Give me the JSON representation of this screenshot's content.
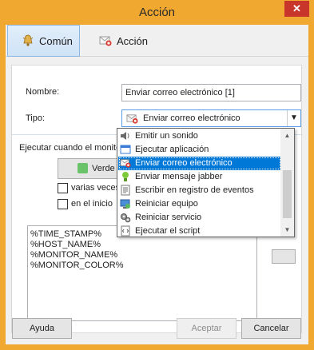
{
  "window": {
    "title": "Acción",
    "close_glyph": "✕"
  },
  "tabs": [
    {
      "label": "Común",
      "icon": "bell-icon",
      "active": true
    },
    {
      "label": "Acción",
      "icon": "action-email-icon",
      "active": false
    }
  ],
  "form": {
    "name_label": "Nombre:",
    "name_value": "Enviar correo electrónico [1]",
    "type_label": "Tipo:",
    "type_value": "Enviar correo electrónico",
    "execute_label": "Ejecutar cuando el monito",
    "state_button_label": "Verde",
    "state_color": "#6ac36a",
    "check_multiple_label": "varias veces",
    "check_start_label": "en el inicio",
    "message_lines": [
      "%TIME_STAMP%",
      "%HOST_NAME%",
      "%MONITOR_NAME%",
      "%MONITOR_COLOR%"
    ]
  },
  "dropdown": {
    "items": [
      {
        "label": "Emitir un sonido",
        "icon": "speaker-icon",
        "selected": false
      },
      {
        "label": "Ejecutar aplicación",
        "icon": "window-app-icon",
        "selected": false
      },
      {
        "label": "Enviar correo electrónico",
        "icon": "email-icon",
        "selected": true
      },
      {
        "label": "Enviar mensaje jabber",
        "icon": "jabber-bulb-icon",
        "selected": false
      },
      {
        "label": "Escribir en registro de eventos",
        "icon": "log-document-icon",
        "selected": false
      },
      {
        "label": "Reiniciar equipo",
        "icon": "restart-computer-icon",
        "selected": false
      },
      {
        "label": "Reiniciar servicio",
        "icon": "gears-icon",
        "selected": false
      },
      {
        "label": "Ejecutar el script",
        "icon": "script-icon",
        "selected": false
      }
    ]
  },
  "buttons": {
    "help": "Ayuda",
    "accept": "Aceptar",
    "cancel": "Cancelar"
  }
}
